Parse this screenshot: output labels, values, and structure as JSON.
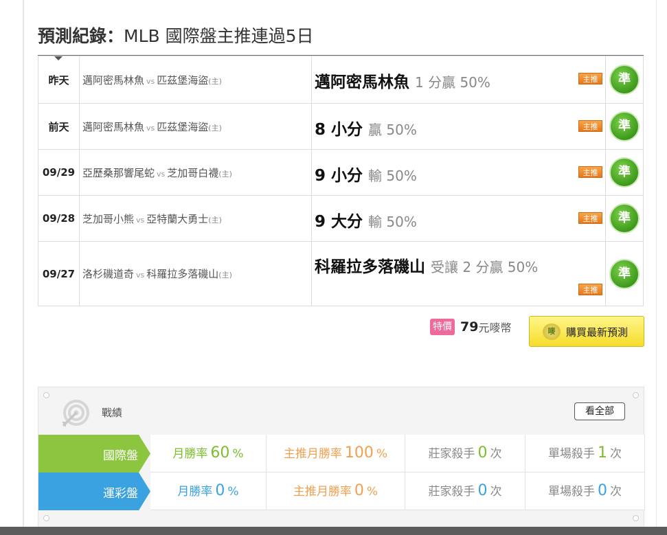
{
  "page": {
    "title_bold": "預測紀錄：",
    "title_rest": "MLB 國際盤主推連過5日"
  },
  "records": [
    {
      "date": "昨天",
      "away": "邁阿密馬林魚",
      "vs": "vs",
      "home": "匹茲堡海盜",
      "home_tag": "(主)",
      "pick": "邁阿密馬林魚",
      "odds": "1 分贏 50%",
      "badge": "主推",
      "result": "準"
    },
    {
      "date": "前天",
      "away": "邁阿密馬林魚",
      "vs": "vs",
      "home": "匹茲堡海盜",
      "home_tag": "(主)",
      "pick": "8 小分",
      "odds": "贏 50%",
      "badge": "主推",
      "result": "準"
    },
    {
      "date": "09/29",
      "away": "亞歷桑那響尾蛇",
      "vs": "vs",
      "home": "芝加哥白襪",
      "home_tag": "(主)",
      "pick": "9 小分",
      "odds": "輸 50%",
      "badge": "主推",
      "result": "準"
    },
    {
      "date": "09/28",
      "away": "芝加哥小熊",
      "vs": "vs",
      "home": "亞特蘭大勇士",
      "home_tag": "(主)",
      "pick": "9 大分",
      "odds": "輸 50%",
      "badge": "主推",
      "result": "準"
    },
    {
      "date": "09/27",
      "away": "洛杉磯道奇",
      "vs": "vs",
      "home": "科羅拉多落磯山",
      "home_tag": "(主)",
      "pick": "科羅拉多落磯山",
      "odds": "受讓 2 分贏 50%",
      "badge": "主推",
      "result": "準"
    }
  ],
  "purchase": {
    "sale_tag": "特價",
    "price": "79",
    "unit": "元嘜幣",
    "icon_text": "嘜",
    "button_label": "購買最新預測"
  },
  "performance": {
    "title": "戰績",
    "see_all": "看全部",
    "rows": [
      {
        "label": "國際盤",
        "color": "#8cc63f",
        "monthly_label": "月勝率",
        "monthly_value": "60",
        "monthly_unit": "%",
        "main_label": "主推月勝率",
        "main_value": "100",
        "main_unit": "%",
        "banker_label": "莊家殺手",
        "banker_value": "0",
        "banker_unit": "次",
        "single_label": "單場殺手",
        "single_value": "1",
        "single_unit": "次"
      },
      {
        "label": "運彩盤",
        "color": "#3aa2e0",
        "monthly_label": "月勝率",
        "monthly_value": "0",
        "monthly_unit": "%",
        "main_label": "主推月勝率",
        "main_value": "0",
        "main_unit": "%",
        "banker_label": "莊家殺手",
        "banker_value": "0",
        "banker_unit": "次",
        "single_label": "單場殺手",
        "single_value": "0",
        "single_unit": "次"
      }
    ]
  },
  "icons": {
    "target": "target-icon",
    "result": "accurate-badge-icon",
    "coin": "coin-icon"
  }
}
